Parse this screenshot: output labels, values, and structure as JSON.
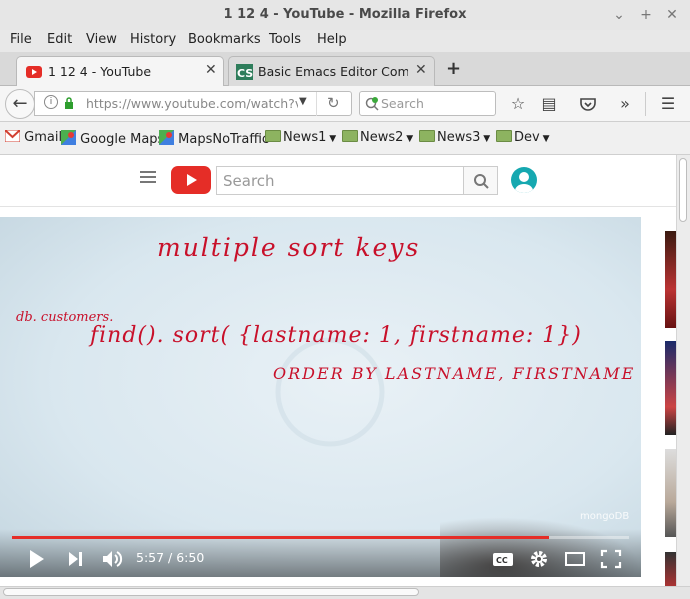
{
  "window": {
    "title": "1 12 4 - YouTube - Mozilla Firefox"
  },
  "menubar": [
    "File",
    "Edit",
    "View",
    "History",
    "Bookmarks",
    "Tools",
    "Help"
  ],
  "tabs": [
    {
      "label": "1 12 4 - YouTube",
      "active": true,
      "icon": "youtube-icon"
    },
    {
      "label": "Basic Emacs Editor Com...",
      "active": false,
      "icon": "cs-site-icon"
    }
  ],
  "navbar": {
    "url": "https://www.youtube.com/watch?v=Ez",
    "search_placeholder": "Search"
  },
  "bookmarks": [
    {
      "label": "Gmail",
      "icon": "gmail-icon"
    },
    {
      "label": "Google Maps",
      "icon": "maps-icon"
    },
    {
      "label": "MapsNoTraffic",
      "icon": "maps-icon"
    },
    {
      "label": "News1",
      "icon": "folder-icon",
      "dropdown": true
    },
    {
      "label": "News2",
      "icon": "folder-icon",
      "dropdown": true
    },
    {
      "label": "News3",
      "icon": "folder-icon",
      "dropdown": true
    },
    {
      "label": "Dev",
      "icon": "folder-icon",
      "dropdown": true
    }
  ],
  "youtube": {
    "search_placeholder": "Search",
    "video": {
      "watermark": "mongoDB",
      "current_time": "5:57",
      "duration": "6:50",
      "time_text": "5:57 / 6:50",
      "progress_fraction": 0.87,
      "whiteboard": {
        "line1": "multiple sort keys",
        "line2_prefix": "db. customers.",
        "line2": "find(). sort( {lastname: 1, firstname: 1})",
        "line3": "ORDER BY LASTNAME, FIRSTNAME"
      }
    }
  },
  "colors": {
    "youtube_red": "#e52d27",
    "ink_red": "#d0102a",
    "avatar": "#16a8b0"
  }
}
